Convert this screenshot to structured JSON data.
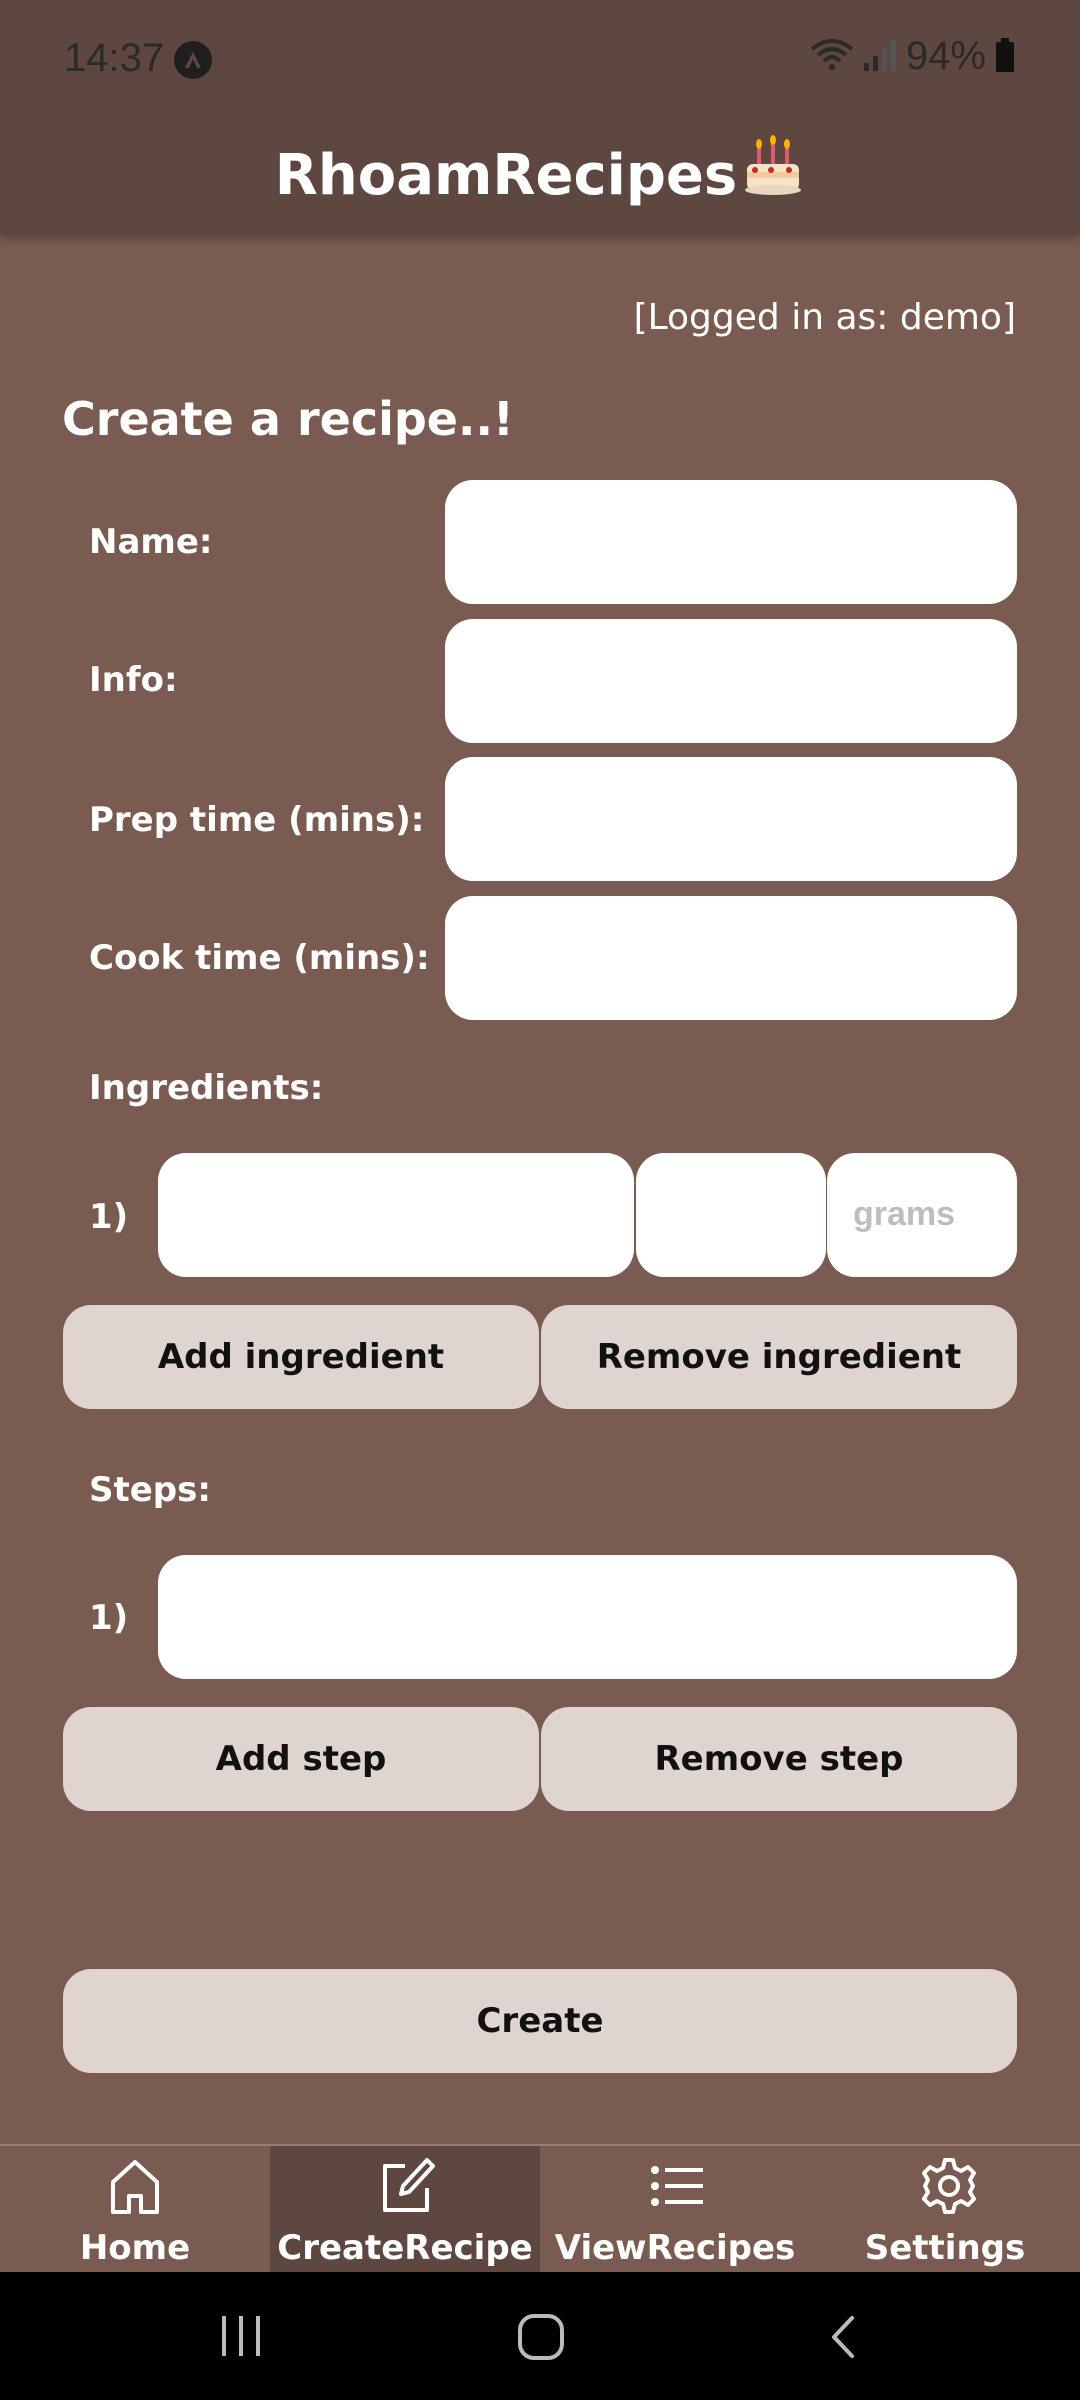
{
  "status": {
    "time": "14:37",
    "battery": "94%"
  },
  "app": {
    "title": "RhoamRecipes"
  },
  "user": {
    "logged_in": "[Logged in as: demo]"
  },
  "form": {
    "heading": "Create a recipe..!",
    "name_label": "Name:",
    "info_label": "Info:",
    "prep_label": "Prep time (mins):",
    "cook_label": "Cook time (mins):",
    "name_value": "",
    "info_value": "",
    "prep_value": "",
    "cook_value": ""
  },
  "ingredients": {
    "label": "Ingredients:",
    "rows": [
      {
        "index": "1)",
        "name": "",
        "amount": "",
        "unit_placeholder": "grams"
      }
    ],
    "add_label": "Add ingredient",
    "remove_label": "Remove ingredient"
  },
  "steps": {
    "label": "Steps:",
    "rows": [
      {
        "index": "1)",
        "text": ""
      }
    ],
    "add_label": "Add step",
    "remove_label": "Remove step"
  },
  "create_label": "Create",
  "nav": {
    "items": [
      {
        "label": "Home",
        "icon": "home-icon"
      },
      {
        "label": "CreateRecipe",
        "icon": "edit-icon",
        "active": true
      },
      {
        "label": "ViewRecipes",
        "icon": "list-icon"
      },
      {
        "label": "Settings",
        "icon": "gear-icon"
      }
    ]
  },
  "colors": {
    "background": "#795B51",
    "appbar": "#5D4740",
    "button": "#E0D4D0",
    "field": "#FFFFFF"
  }
}
